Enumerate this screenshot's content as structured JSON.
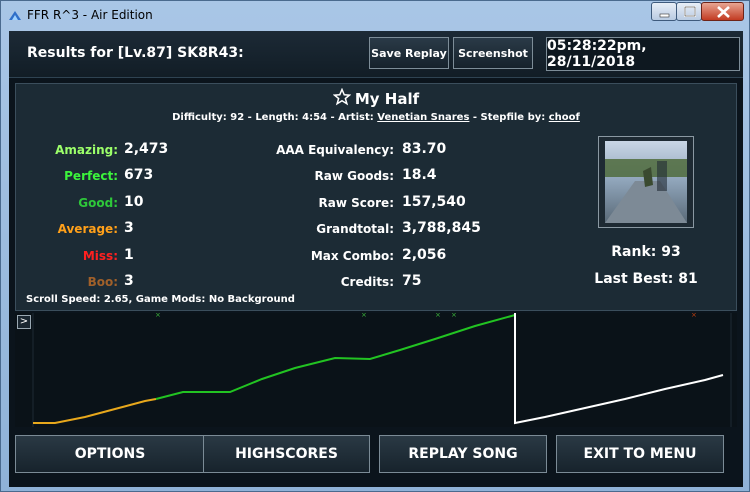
{
  "window": {
    "title": "FFR R^3 - Air Edition"
  },
  "header": {
    "results_title": "Results for [Lv.87] SK8R43:",
    "save_replay_label": "Save Replay",
    "screenshot_label": "Screenshot",
    "datetime": "05:28:22pm, 28/11/2018"
  },
  "song": {
    "title": "My Half",
    "difficulty_label": "Difficulty:",
    "difficulty": "92",
    "length_label": "Length:",
    "length": "4:54",
    "artist_label": "Artist:",
    "artist": "Venetian Snares",
    "stepfile_label": "Stepfile by:",
    "stepfile_by": "choof"
  },
  "judgements": [
    {
      "label": "Amazing:",
      "value": "2,473",
      "color": "#9cff6a"
    },
    {
      "label": "Perfect:",
      "value": "673",
      "color": "#3cf43c"
    },
    {
      "label": "Good:",
      "value": "10",
      "color": "#2ec83a"
    },
    {
      "label": "Average:",
      "value": "3",
      "color": "#ffa01a"
    },
    {
      "label": "Miss:",
      "value": "1",
      "color": "#ff2020"
    },
    {
      "label": "Boo:",
      "value": "3",
      "color": "#a0602a"
    }
  ],
  "stats": [
    {
      "label": "AAA Equivalency:",
      "value": "83.70"
    },
    {
      "label": "Raw Goods:",
      "value": "18.4"
    },
    {
      "label": "Raw Score:",
      "value": "157,540"
    },
    {
      "label": "Grandtotal:",
      "value": "3,788,845"
    },
    {
      "label": "Max Combo:",
      "value": "2,056"
    },
    {
      "label": "Credits:",
      "value": "75"
    }
  ],
  "player": {
    "rank_label": "Rank:",
    "rank": "93",
    "last_best_label": "Last Best:",
    "last_best": "81"
  },
  "scroll_info": "Scroll Speed: 2.65, Game Mods: No Background",
  "graph": {
    "expand_label": ">"
  },
  "buttons": {
    "options": "OPTIONS",
    "highscores": "HIGHSCORES",
    "replay": "REPLAY SONG",
    "exit": "EXIT TO MENU"
  },
  "colors": {
    "amazing": "#9cff6a",
    "perfect": "#3cf43c",
    "average_line": "#e8a81c",
    "score_line": "#22c322",
    "combo_line": "#ffffff"
  }
}
